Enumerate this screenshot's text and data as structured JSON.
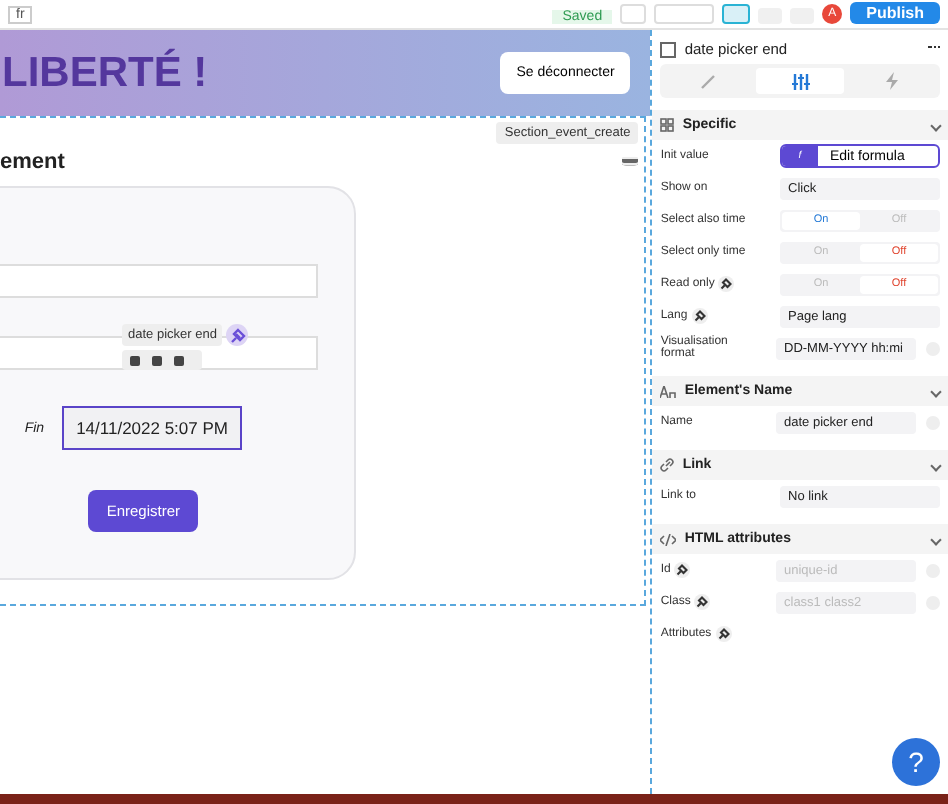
{
  "topbar": {
    "language": "fr",
    "saved": "Saved",
    "publish": "Publish",
    "avatar": "A",
    "devices": [
      {
        "selected": true
      },
      {
        "selected": false
      },
      {
        "selected": false
      }
    ]
  },
  "canvas": {
    "brand": "LIBERTÉ !",
    "logout": "Se déconnecter",
    "section_label": "Section_event_create",
    "heading": "ement",
    "tag": "date picker end",
    "end_label": "Fin",
    "end_value": "14/11/2022 5:07 PM",
    "save": "Enregistrer"
  },
  "panel": {
    "element": "date picker end",
    "tabs": [
      {
        "kind": "style",
        "selected": false
      },
      {
        "kind": "settings",
        "selected": true
      },
      {
        "kind": "workflow",
        "selected": false
      }
    ],
    "sections": [
      {
        "title": "Specific",
        "rows": [
          {
            "kind": "formula",
            "label": "Init value",
            "value": "Edit formula",
            "badge": "f"
          },
          {
            "kind": "select",
            "label": "Show on",
            "value": "Click"
          },
          {
            "kind": "toggle",
            "label": "Select also time",
            "on": "On",
            "off": "Off",
            "checked": true
          },
          {
            "kind": "toggle",
            "label": "Select only time",
            "on": "On",
            "off": "Off",
            "checked": false
          },
          {
            "kind": "toggle",
            "label": "Read only",
            "plug": true,
            "on": "On",
            "off": "Off",
            "checked": false
          },
          {
            "kind": "select",
            "label": "Lang",
            "plug": true,
            "value": "Page lang"
          },
          {
            "kind": "text",
            "label": "Visualisation format",
            "value": "DD-MM-YYYY hh:mi"
          }
        ]
      },
      {
        "title": "Element's Name",
        "rows": [
          {
            "kind": "text",
            "label": "Name",
            "value": "date picker end"
          }
        ]
      },
      {
        "title": "Link",
        "rows": [
          {
            "kind": "select",
            "label": "Link to",
            "value": "No link"
          }
        ]
      },
      {
        "title": "HTML attributes",
        "rows": [
          {
            "kind": "text",
            "label": "Id",
            "plug": true,
            "placeholder": "unique-id"
          },
          {
            "kind": "text",
            "label": "Class",
            "plug": true,
            "placeholder": "class1 class2"
          },
          {
            "kind": "none",
            "label": "Attributes",
            "plug": true
          }
        ]
      }
    ],
    "help": "?"
  }
}
